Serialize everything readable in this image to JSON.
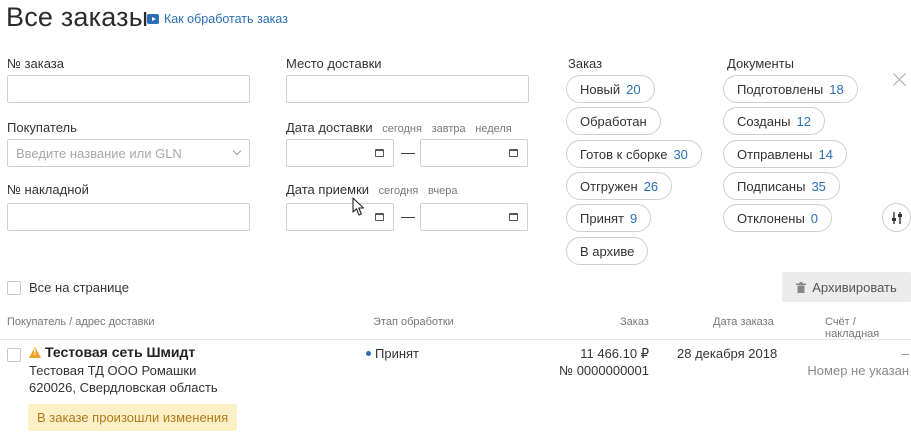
{
  "header": {
    "title": "Все заказы",
    "help_link": "Как обработать заказ"
  },
  "filters": {
    "order_number": {
      "label": "№ заказа",
      "value": ""
    },
    "delivery_place": {
      "label": "Место доставки",
      "value": ""
    },
    "buyer": {
      "label": "Покупатель",
      "placeholder": "Введите название или GLN"
    },
    "delivery_date": {
      "label": "Дата доставки",
      "quick": [
        "сегодня",
        "завтра",
        "неделя"
      ],
      "from": "",
      "to": "",
      "separator": "—"
    },
    "invoice_number": {
      "label": "№ накладной",
      "value": ""
    },
    "acceptance_date": {
      "label": "Дата приемки",
      "quick": [
        "сегодня",
        "вчера"
      ],
      "from": "",
      "to": "",
      "separator": "—"
    }
  },
  "order_status": {
    "title": "Заказ",
    "items": [
      {
        "label": "Новый",
        "count": "20"
      },
      {
        "label": "Обработан",
        "count": ""
      },
      {
        "label": "Готов к сборке",
        "count": "30"
      },
      {
        "label": "Отгружен",
        "count": "26"
      },
      {
        "label": "Принят",
        "count": "9"
      },
      {
        "label": "В архиве",
        "count": ""
      }
    ]
  },
  "documents_status": {
    "title": "Документы",
    "items": [
      {
        "label": "Подготовлены",
        "count": "18"
      },
      {
        "label": "Созданы",
        "count": "12"
      },
      {
        "label": "Отправлены",
        "count": "14"
      },
      {
        "label": "Подписаны",
        "count": "35"
      },
      {
        "label": "Отклонены",
        "count": "0"
      }
    ]
  },
  "bulk": {
    "select_all_label": "Все на странице",
    "archive_label": "Архивировать"
  },
  "table": {
    "headers": {
      "buyer": "Покупатель / адрес доставки",
      "stage": "Этап обработки",
      "order": "Заказ",
      "date": "Дата заказа",
      "invoice": "Счёт / накладная"
    },
    "rows": [
      {
        "buyer_name": "Тестовая сеть Шмидт",
        "buyer_company": "Тестовая ТД ООО Ромашки",
        "buyer_address": "620026, Свердловская область",
        "stage": "Принят",
        "amount": "11 466.10 ₽",
        "order_number": "№ 0000000001",
        "order_date": "28 декабря 2018",
        "invoice_dash": "–",
        "invoice_status": "Номер не указан",
        "notice": "В заказе произошли изменения"
      }
    ]
  },
  "colors": {
    "accent": "#2a6fb6",
    "warning": "#f0a020",
    "notice_bg": "#fdf0c7",
    "notice_text": "#b07a18"
  }
}
